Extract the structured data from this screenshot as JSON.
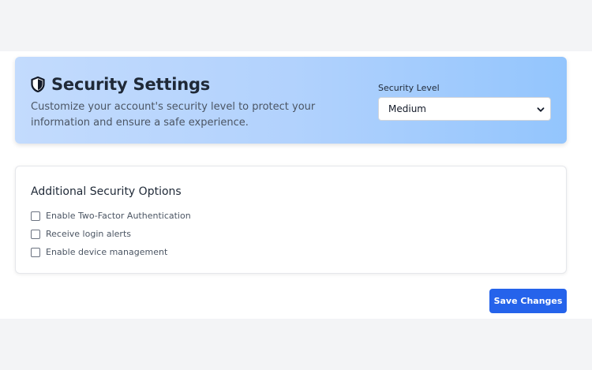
{
  "header": {
    "title": "Security Settings",
    "description": "Customize your account's security level to protect your information and ensure a safe experience."
  },
  "security_level": {
    "label": "Security Level",
    "selected": "Medium"
  },
  "options": {
    "title": "Additional Security Options",
    "items": [
      {
        "label": "Enable Two-Factor Authentication",
        "checked": false
      },
      {
        "label": "Receive login alerts",
        "checked": false
      },
      {
        "label": "Enable device management",
        "checked": false
      }
    ]
  },
  "actions": {
    "save_label": "Save Changes"
  },
  "colors": {
    "primary": "#2563eb",
    "hero_gradient_start": "#c3dbfd",
    "hero_gradient_end": "#93c5fd"
  },
  "icons": {
    "title_icon": "shield-icon",
    "select_icon": "chevron-down-icon"
  }
}
